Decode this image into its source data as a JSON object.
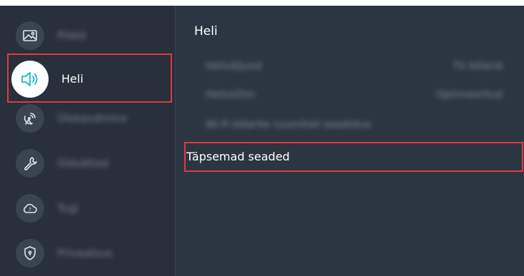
{
  "sidebar": {
    "items": [
      {
        "label": "Pildid",
        "icon": "picture-icon"
      },
      {
        "label": "Heli",
        "icon": "sound-icon"
      },
      {
        "label": "Ülekandmine",
        "icon": "broadcasting-icon"
      },
      {
        "label": "Üldsätted",
        "icon": "wrench-icon"
      },
      {
        "label": "Tugi",
        "icon": "support-icon"
      },
      {
        "label": "Privaatsus",
        "icon": "privacy-shield-icon"
      }
    ],
    "selected_index": 1
  },
  "panel": {
    "title": "Heli",
    "rows": [
      {
        "label": "Heliväljund",
        "value": "TV kõlarid"
      },
      {
        "label": "Helirežiim",
        "value": "Optimeeritud"
      },
      {
        "label": "Wi-Fi kõlarite ruumiheli seadistus",
        "value": ""
      },
      {
        "label": "Täpsemad seaded",
        "value": ""
      }
    ],
    "focused_row_index": 3
  },
  "colors": {
    "background": "#2c3642",
    "sidebar": "#27303b",
    "focus_outline": "#e2393f",
    "selected_icon_accent": "#14b8c4"
  }
}
